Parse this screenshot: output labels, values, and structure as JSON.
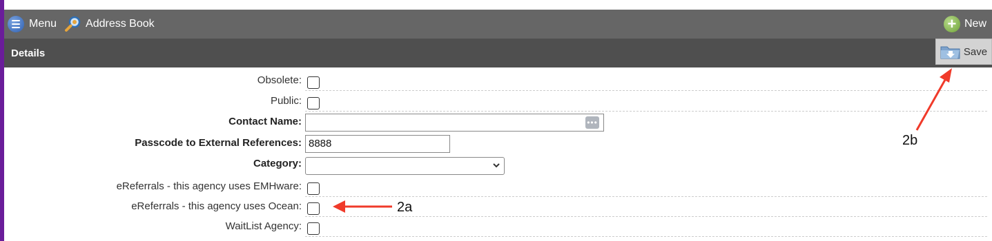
{
  "topbar": {
    "menu_label": "Menu",
    "app_label": "Address Book",
    "new_label": "New"
  },
  "subbar": {
    "title": "Details",
    "save_label": "Save"
  },
  "form": {
    "obsolete_label": "Obsolete:",
    "public_label": "Public:",
    "contact_name_label": "Contact Name:",
    "contact_name_value": "",
    "passcode_label": "Passcode to External References:",
    "passcode_value": "8888",
    "category_label": "Category:",
    "category_value": "",
    "emhware_label": "eReferrals - this agency uses EMHware:",
    "ocean_label": "eReferrals - this agency uses Ocean:",
    "waitlist_label": "WaitList Agency:"
  },
  "annotations": {
    "a2a": "2a",
    "a2b": "2b"
  },
  "colors": {
    "accent_purple": "#6a1d9a",
    "topbar": "#666666",
    "subbar": "#4f4f4f",
    "annotation_arrow": "#f03a2a"
  }
}
